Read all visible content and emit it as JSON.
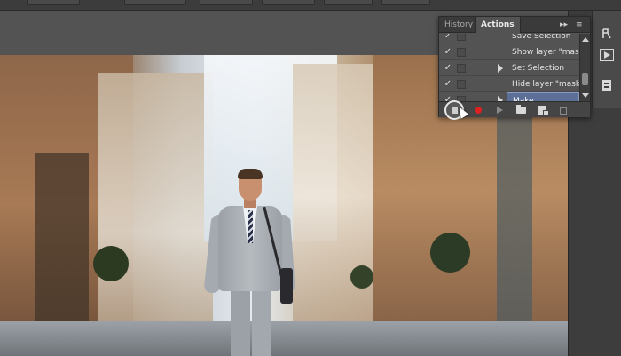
{
  "panel": {
    "tabs": [
      {
        "label": "History"
      },
      {
        "label": "Actions"
      }
    ],
    "collapse_label": "▸▸",
    "menu_label": "≡",
    "rows": [
      {
        "check": "✓",
        "label": "Save Selection",
        "has_triangle": false
      },
      {
        "check": "✓",
        "label": "Show layer \"mas...",
        "has_triangle": false
      },
      {
        "check": "✓",
        "label": "Set Selection",
        "has_triangle": true
      },
      {
        "check": "✓",
        "label": "Hide layer \"mask...",
        "has_triangle": false
      },
      {
        "check": "✓",
        "label": "Make",
        "has_triangle": true,
        "selected": true
      }
    ]
  },
  "colors": {
    "record": "#e02020",
    "selection": "#5c6f96"
  },
  "icons": {
    "right_strip": [
      "history-brush-icon",
      "play-action-icon",
      "properties-icon"
    ]
  }
}
